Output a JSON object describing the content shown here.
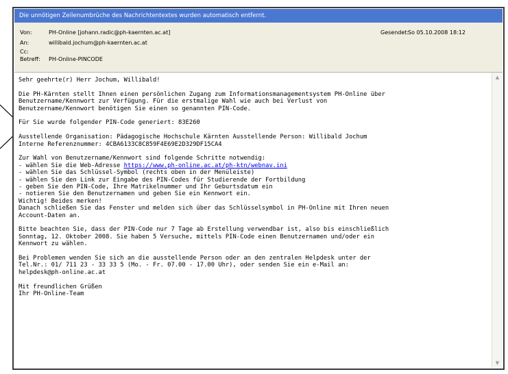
{
  "infobar": {
    "text": "Die unnötigen Zeilenumbrüche des Nachrichtentextes wurden automatisch entfernt."
  },
  "header": {
    "from_label": "Von:",
    "from_value": "PH-Online [johann.radic@ph-kaernten.ac.at]",
    "to_label": "An:",
    "to_value": "willibald.jochum@ph-kaernten.ac.at",
    "cc_label": "Cc:",
    "cc_value": "",
    "subject_label": "Betreff:",
    "subject_value": "PH-Online-PINCODE",
    "sent_label": "Gesendet:",
    "sent_value": "So 05.10.2008 18:12"
  },
  "body": {
    "greeting": "Sehr geehrte(r) Herr Jochum, Willibald!",
    "p1": [
      "Die PH-Kärnten stellt Ihnen einen persönlichen Zugang zum Informationsmanagementsystem PH-Online über",
      "Benutzername/Kennwort zur Verfügung. Für die erstmalige Wahl wie auch bei Verlust von",
      "Benutzername/Kennwort benötigen Sie einen so genannten PIN-Code."
    ],
    "p2": "Für Sie wurde folgender PIN-Code generiert: 83E260",
    "p3": [
      "Ausstellende Organisation: Pädagogische Hochschule Kärnten Ausstellende Person: Willibald Jochum",
      "Interne Referenznummer: 4CBA6133C8C859F4E69E2D329DF15CA4"
    ],
    "steps_intro": "Zur Wahl von Benutzername/Kennwort sind folgende Schritte notwendig:",
    "step1_prefix": "- wählen Sie die Web-Adresse ",
    "step1_link": "https://www.ph-online.ac.at/ph-ktn/webnav.ini",
    "steps": [
      "- wählen Sie das Schlüssel-Symbol (rechts oben in der Menüleiste)",
      "- wählen Sie den Link zur Eingabe des PIN-Codes für Studierende der Fortbildung",
      "- geben Sie den PIN-Code, Ihre Matrikelnummer und Ihr Geburtsdatum ein",
      "- notieren Sie den Benutzernamen und geben Sie ein Kennwort ein.",
      "Wichtig! Beides merken!",
      "Danach schließen Sie das Fenster und melden sich über das Schlüsselsymbol in PH-Online mit Ihren neuen",
      "Account-Daten an."
    ],
    "p5": [
      "Bitte beachten Sie, dass der PIN-Code nur 7 Tage ab Erstellung verwendbar ist, also bis einschließlich",
      "Sonntag, 12. Oktober 2008. Sie haben 5 Versuche, mittels PIN-Code einen Benutzernamen und/oder ein",
      "Kennwort zu wählen."
    ],
    "p6": [
      "Bei Problemen wenden Sie sich an die ausstellende Person oder an den zentralen Helpdesk unter der",
      "Tel.Nr.: 01/ 711 23 - 33 33 5 (Mo. - Fr. 07.00 - 17.00 Uhr), oder senden Sie ein e-Mail an:",
      "helpdesk@ph-online.ac.at"
    ],
    "closing": [
      "Mit freundlichen Grüßen",
      "Ihr PH-Online-Team"
    ]
  },
  "scrollbar": {
    "up_icon": "chevron-up-icon",
    "down_icon": "chevron-down-icon"
  }
}
